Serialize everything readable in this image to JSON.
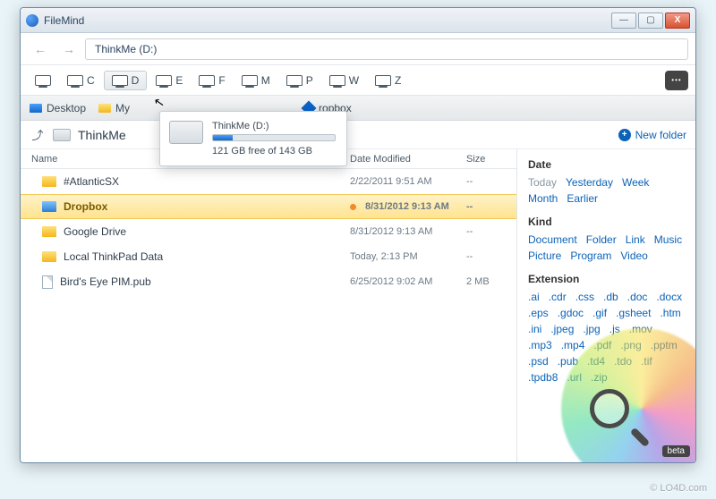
{
  "window": {
    "title": "FileMind"
  },
  "address": {
    "path": "ThinkMe (D:)"
  },
  "drives": [
    "C",
    "D",
    "E",
    "F",
    "M",
    "P",
    "W",
    "Z"
  ],
  "breadcrumb": {
    "desktop": "Desktop",
    "mycomputer": "My",
    "dropbox": "ropbox"
  },
  "location": {
    "name": "ThinkMe",
    "newfolder": "New folder"
  },
  "columns": {
    "name": "Name",
    "date": "Date Modified",
    "size": "Size"
  },
  "files": [
    {
      "name": "#AtlanticSX",
      "date": "2/22/2011 9:51 AM",
      "size": "--",
      "icon": "folder"
    },
    {
      "name": "Dropbox",
      "date": "8/31/2012 9:13 AM",
      "size": "--",
      "icon": "folder-blue",
      "selected": true,
      "sync": true
    },
    {
      "name": "Google Drive",
      "date": "8/31/2012 9:13 AM",
      "size": "--",
      "icon": "folder"
    },
    {
      "name": "Local ThinkPad Data",
      "date": "Today, 2:13 PM",
      "size": "--",
      "icon": "folder"
    },
    {
      "name": "Bird's Eye PIM.pub",
      "date": "6/25/2012 9:02 AM",
      "size": "2 MB",
      "icon": "file"
    }
  ],
  "tooltip": {
    "title": "ThinkMe (D:)",
    "free": "121 GB free of 143 GB"
  },
  "sidebar": {
    "date": {
      "title": "Date",
      "items": [
        "Today",
        "Yesterday",
        "Week",
        "Month",
        "Earlier"
      ]
    },
    "kind": {
      "title": "Kind",
      "items": [
        "Document",
        "Folder",
        "Link",
        "Music",
        "Picture",
        "Program",
        "Video"
      ]
    },
    "extension": {
      "title": "Extension",
      "items": [
        ".ai",
        ".cdr",
        ".css",
        ".db",
        ".doc",
        ".docx",
        ".eps",
        ".gdoc",
        ".gif",
        ".gsheet",
        ".htm",
        ".ini",
        ".jpeg",
        ".jpg",
        ".js",
        ".mov",
        ".mp3",
        ".mp4",
        ".pdf",
        ".png",
        ".pptm",
        ".psd",
        ".pub",
        ".td4",
        ".tdo",
        ".tif",
        ".tpdb8",
        ".url",
        ".zip"
      ]
    }
  },
  "beta": "beta",
  "watermark": "© LO4D.com"
}
